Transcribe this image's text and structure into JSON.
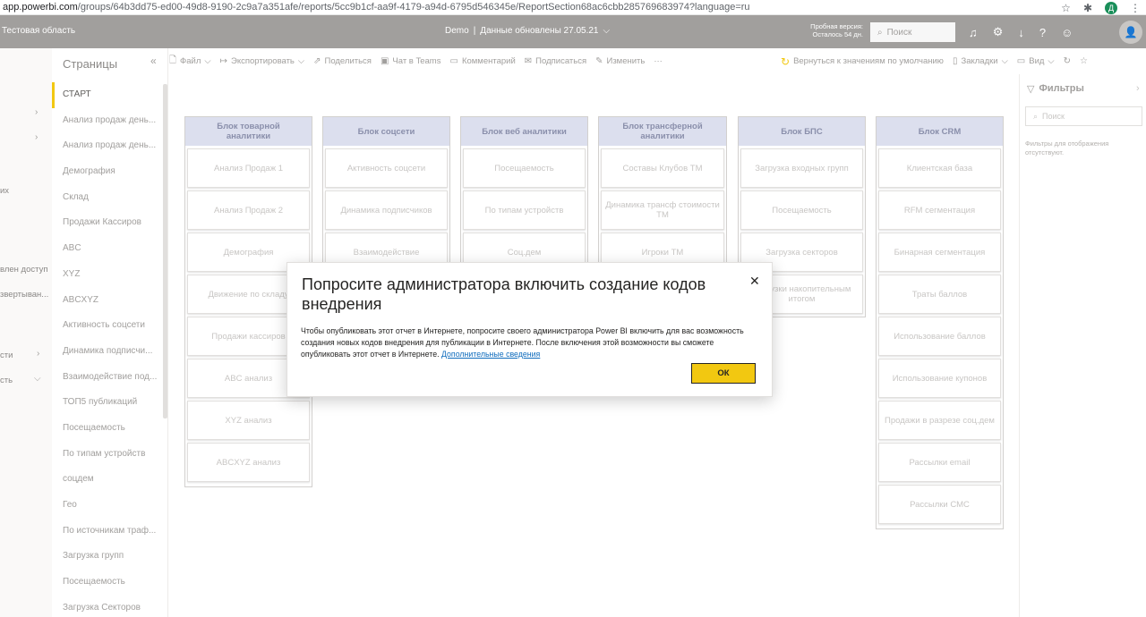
{
  "browser": {
    "url_host": "app.powerbi.com",
    "url_path": "/groups/64b3dd75-ed00-49d8-9190-2c9a7a351afe/reports/5cc9b1cf-aa9f-4179-a94d-6795d546345e/ReportSection68ac6cbb285769683974?language=ru",
    "profile_letter": "Д"
  },
  "header": {
    "workspace": "Тестовая область",
    "report_name": "Demo",
    "separator": "|",
    "updated": "Данные обновлены 27.05.21",
    "trial_line1": "Пробная версия:",
    "trial_line2": "Осталось 54 дн.",
    "search_placeholder": "Поиск"
  },
  "leftnav": {
    "items": [
      "их",
      "влен доступ",
      "звертыван...",
      "сти",
      "сть"
    ]
  },
  "pages": {
    "title": "Страницы",
    "items": [
      "СТАРТ",
      "Анализ продаж день...",
      "Анализ продаж день...",
      "Демография",
      "Склад",
      "Продажи Кассиров",
      "ABC",
      "XYZ",
      "ABCXYZ",
      "Активность соцсети",
      "Динамика подписчи...",
      "Взаимодействие под...",
      "ТОП5 публикаций",
      "Посещаемость",
      "По типам устройств",
      "соцдем",
      "Гео",
      "По источникам траф...",
      "Загрузка групп",
      "Посещаемость",
      "Загрузка Секторов"
    ]
  },
  "toolbar": {
    "file": "Файл",
    "export": "Экспортировать",
    "share": "Поделиться",
    "teams": "Чат в Teams",
    "comment": "Комментарий",
    "subscribe": "Подписаться",
    "edit": "Изменить",
    "more": "···",
    "reset": "Вернуться к значениям по умолчанию",
    "bookmarks": "Закладки",
    "view": "Вид"
  },
  "canvas": {
    "columns": [
      {
        "title": "Блок товарной аналитики",
        "buttons": [
          "Анализ Продаж 1",
          "Анализ Продаж 2",
          "Демография",
          "Движение по складу",
          "Продажи кассиров",
          "ABC анализ",
          "XYZ анализ",
          "ABCXYZ анализ"
        ]
      },
      {
        "title": "Блок соцсети",
        "buttons": [
          "Активность соцсети",
          "Динамика подписчиков",
          "Взаимодействие"
        ]
      },
      {
        "title": "Блок веб аналитики",
        "buttons": [
          "Посещаемость",
          "По типам устройств",
          "Соц.дем"
        ]
      },
      {
        "title": "Блок трансферной аналитики",
        "buttons": [
          "Составы Клубов ТМ",
          "Динамика трансф стоимости ТМ",
          "Игроки ТМ"
        ]
      },
      {
        "title": "Блок БПС",
        "buttons": [
          "Загрузка входных групп",
          "Посещаемость",
          "Загрузка секторов",
          "Загрузки накопительным итогом"
        ]
      },
      {
        "title": "Блок CRM",
        "buttons": [
          "Клиентская база",
          "RFM сегментация",
          "Бинарная сегментация",
          "Траты баллов",
          "Использование баллов",
          "Использование купонов",
          "Продажи в разрезе соц.дем",
          "Рассылки email",
          "Рассылки СМС"
        ]
      }
    ]
  },
  "filters": {
    "title": "Фильтры",
    "search_placeholder": "Поиск",
    "note": "Фильтры для отображения отсутствуют."
  },
  "modal": {
    "title": "Попросите администратора включить создание кодов внедрения",
    "body": "Чтобы опубликовать этот отчет в Интернете, попросите своего администратора Power BI включить для вас возможность создания новых кодов внедрения для публикации в Интернете. После включения этой возможности вы сможете опубликовать этот отчет в Интернете. ",
    "link": "Дополнительные сведения",
    "ok": "ОК"
  }
}
